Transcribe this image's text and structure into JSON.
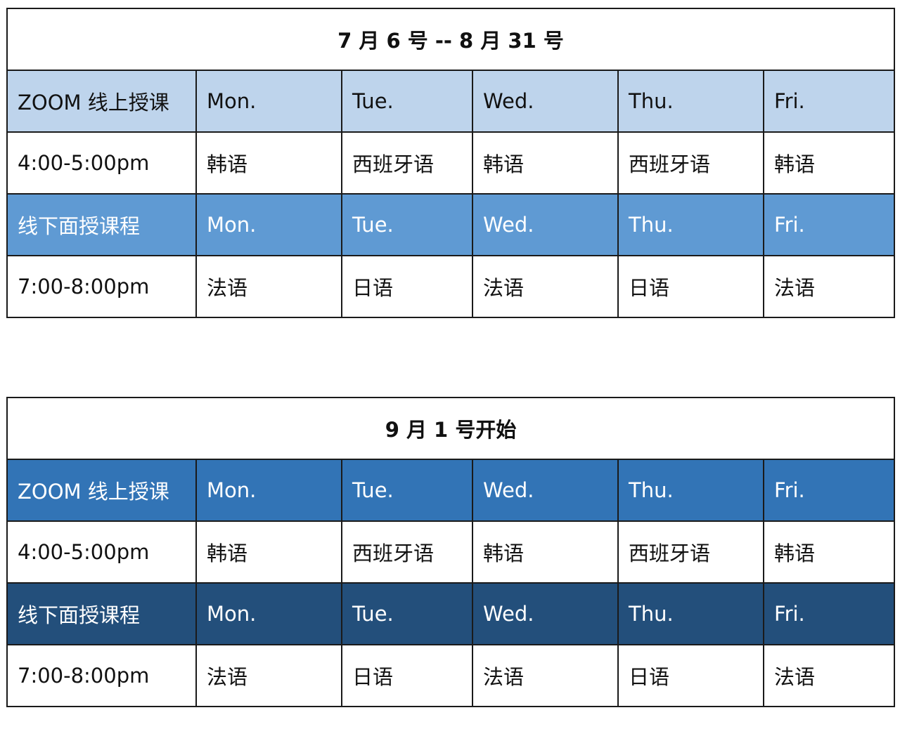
{
  "colors": {
    "border": "#1a1a1a",
    "table1_online_header_bg": "#bed4ec",
    "table1_online_header_text": "#111111",
    "table1_offline_header_bg": "#5f9ad3",
    "table1_offline_header_text": "#ffffff",
    "table2_online_header_bg": "#3274b6",
    "table2_online_header_text": "#ffffff",
    "table2_offline_header_bg": "#234f7b",
    "table2_offline_header_text": "#ffffff"
  },
  "tables": [
    {
      "title": "7 月 6 号 -- 8 月 31 号",
      "online_header": [
        "ZOOM 线上授课",
        "Mon.",
        "Tue.",
        "Wed.",
        "Thu.",
        "Fri."
      ],
      "online_row": [
        "4:00-5:00pm",
        "韩语",
        "西班牙语",
        "韩语",
        "西班牙语",
        "韩语"
      ],
      "offline_header": [
        "线下面授课程",
        "Mon.",
        "Tue.",
        "Wed.",
        "Thu.",
        "Fri."
      ],
      "offline_row": [
        "7:00-8:00pm",
        "法语",
        "日语",
        "法语",
        "日语",
        "法语"
      ]
    },
    {
      "title": "9 月 1 号开始",
      "online_header": [
        "ZOOM 线上授课",
        "Mon.",
        "Tue.",
        "Wed.",
        "Thu.",
        "Fri."
      ],
      "online_row": [
        "4:00-5:00pm",
        "韩语",
        "西班牙语",
        "韩语",
        "西班牙语",
        "韩语"
      ],
      "offline_header": [
        "线下面授课程",
        "Mon.",
        "Tue.",
        "Wed.",
        "Thu.",
        "Fri."
      ],
      "offline_row": [
        "7:00-8:00pm",
        "法语",
        "日语",
        "法语",
        "日语",
        "法语"
      ]
    }
  ]
}
